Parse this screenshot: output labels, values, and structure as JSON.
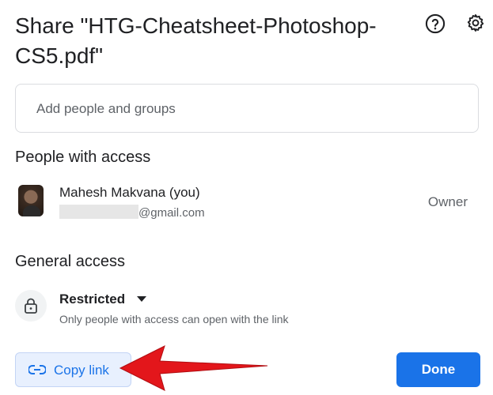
{
  "dialog": {
    "title": "Share \"HTG-Cheatsheet-Photoshop-CS5.pdf\"",
    "help_icon": "help-circle-icon",
    "settings_icon": "gear-icon"
  },
  "add_people": {
    "placeholder": "Add people and groups"
  },
  "people_section": {
    "heading": "People with access",
    "people": [
      {
        "name": "Mahesh Makvana (you)",
        "email_suffix": "@gmail.com",
        "role": "Owner"
      }
    ]
  },
  "general_access": {
    "heading": "General access",
    "icon": "lock-icon",
    "selected": "Restricted",
    "description": "Only people with access can open with the link"
  },
  "footer": {
    "copy_link_label": "Copy link",
    "done_label": "Done"
  },
  "colors": {
    "primary": "#1a73e8",
    "copy_bg": "#e8f0fe",
    "annotation_arrow": "#e3161b"
  }
}
